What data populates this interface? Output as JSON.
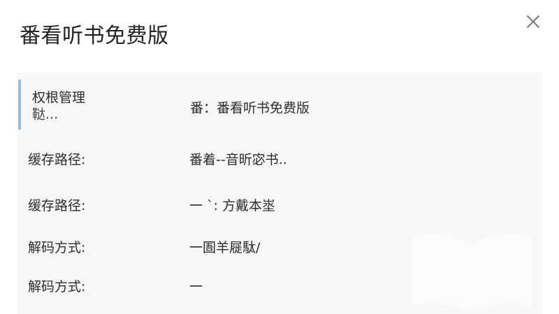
{
  "dialog": {
    "title": "番看听书免费版"
  },
  "rows": [
    {
      "label": "权根管理",
      "label_sub": "鞑...",
      "value": "番：番看听书免费版"
    },
    {
      "label": "缓存路径:",
      "value": "番着--音昕宓书.."
    },
    {
      "label": "缓存路径:",
      "value": "一 `: 方戴本埊"
    },
    {
      "label": "解码方式:",
      "value": "一圄羊屣駄/"
    },
    {
      "label": "解码方式:",
      "value": "一"
    }
  ],
  "icons": {
    "close": "close-icon",
    "watermark": "book-icon"
  },
  "colors": {
    "accent": "#9dbce0",
    "panel_bg": "#f7f7f7"
  }
}
